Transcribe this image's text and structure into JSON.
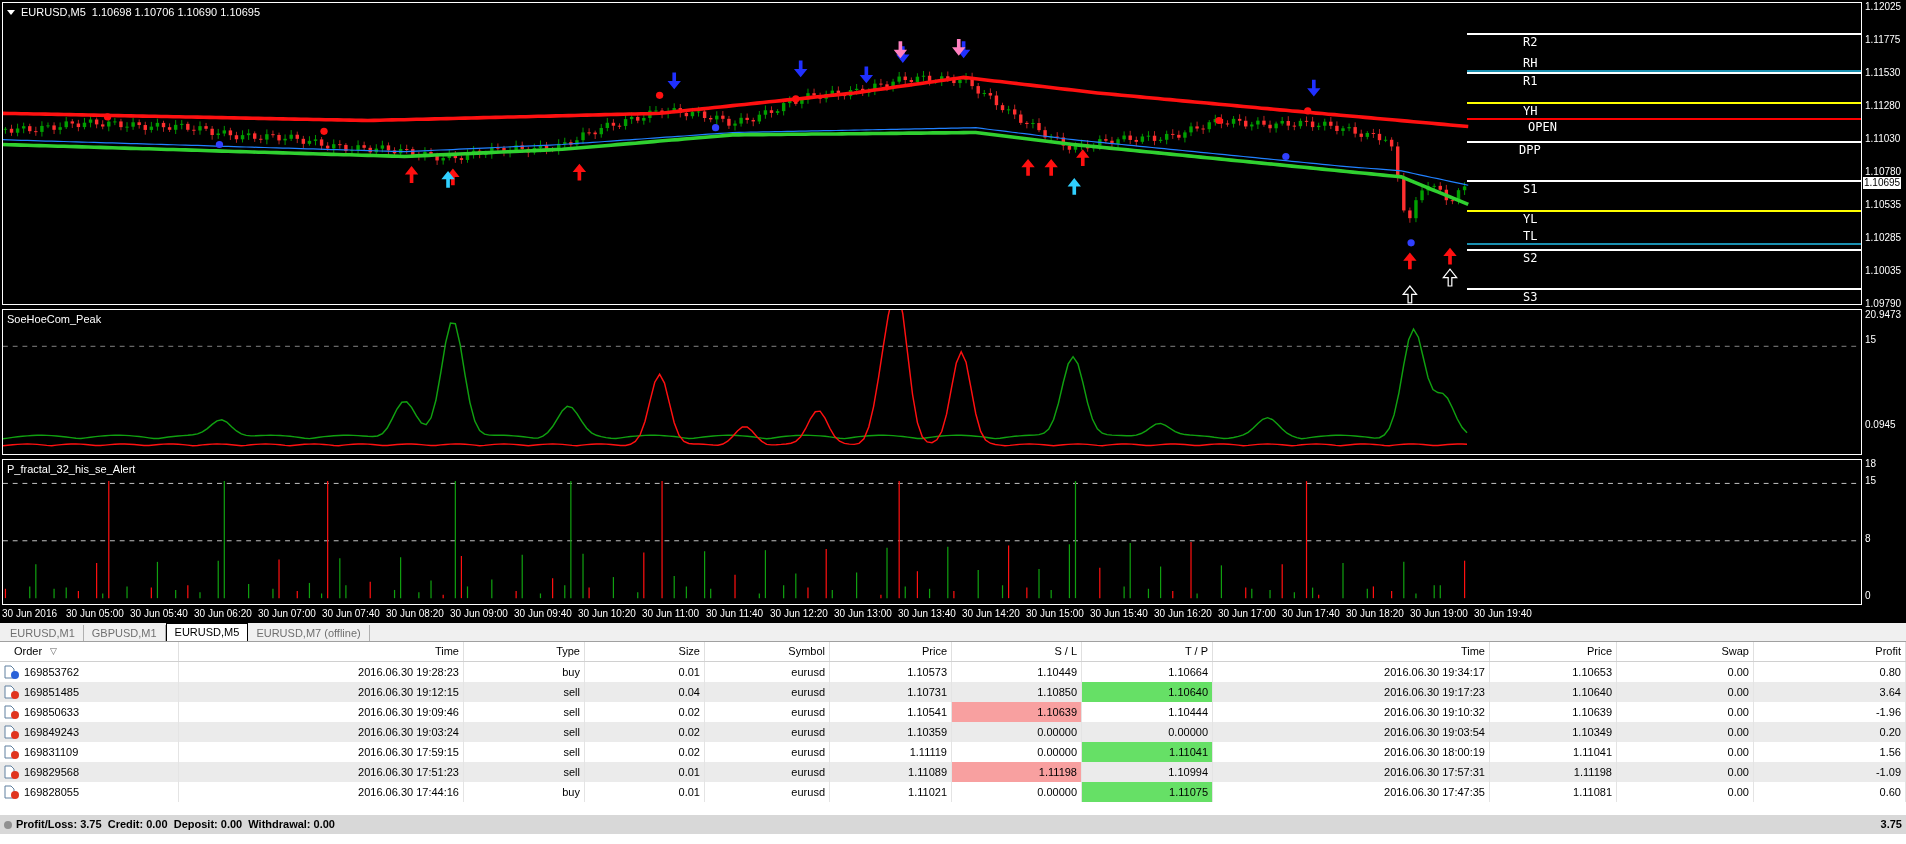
{
  "chart": {
    "symbol": "EURUSD,M5",
    "ohlc": "1.10698 1.10706 1.10690 1.10695",
    "price_ticks": [
      "1.12025",
      "1.11775",
      "1.11530",
      "1.11280",
      "1.11030",
      "1.10780",
      "1.10535",
      "1.10285",
      "1.10035",
      "1.09790"
    ],
    "current_price": "1.10695",
    "pivots": [
      {
        "label": "R2",
        "color": "#ffffff"
      },
      {
        "label": "RH",
        "color": "#1a8fb0"
      },
      {
        "label": "R1",
        "color": "#ffffff"
      },
      {
        "label": "YH",
        "color": "#ffff00"
      },
      {
        "label": "OPEN",
        "color": "#ff0000"
      },
      {
        "label": "DPP",
        "color": "#ffffff"
      },
      {
        "label": "S1",
        "color": "#ffffff"
      },
      {
        "label": "YL",
        "color": "#ffff00"
      },
      {
        "label": "TL",
        "color": "#1a8fb0"
      },
      {
        "label": "S2",
        "color": "#ffffff"
      },
      {
        "label": "S3",
        "color": "#ffffff"
      }
    ]
  },
  "indicators": [
    {
      "title": "SoeHoeCom_Peak",
      "ticks": [
        "20.9473",
        "15",
        "0.0945"
      ]
    },
    {
      "title": "P_fractal_32_his_se_Alert",
      "ticks": [
        "18",
        "15",
        "8",
        "0"
      ]
    }
  ],
  "time_axis": [
    "30 Jun 2016",
    "30 Jun 05:00",
    "30 Jun 05:40",
    "30 Jun 06:20",
    "30 Jun 07:00",
    "30 Jun 07:40",
    "30 Jun 08:20",
    "30 Jun 09:00",
    "30 Jun 09:40",
    "30 Jun 10:20",
    "30 Jun 11:00",
    "30 Jun 11:40",
    "30 Jun 12:20",
    "30 Jun 13:00",
    "30 Jun 13:40",
    "30 Jun 14:20",
    "30 Jun 15:00",
    "30 Jun 15:40",
    "30 Jun 16:20",
    "30 Jun 17:00",
    "30 Jun 17:40",
    "30 Jun 18:20",
    "30 Jun 19:00",
    "30 Jun 19:40"
  ],
  "tabs": [
    {
      "label": "EURUSD,M1",
      "selected": false
    },
    {
      "label": "GBPUSD,M1",
      "selected": false
    },
    {
      "label": "EURUSD,M5",
      "selected": true
    },
    {
      "label": "EURUSD,M7 (offline)",
      "selected": false
    }
  ],
  "table": {
    "sort_icon": "▽",
    "columns": [
      "Order",
      "Time",
      "Type",
      "Size",
      "Symbol",
      "Price",
      "S / L",
      "T / P",
      "Time",
      "Price",
      "Swap",
      "Profit"
    ],
    "rows": [
      {
        "color": "#2a62d8",
        "order": "169853762",
        "open_time": "2016.06.30 19:28:23",
        "type": "buy",
        "size": "0.01",
        "symbol": "eurusd",
        "open_price": "1.10573",
        "sl": "1.10449",
        "sl_hit": false,
        "tp": "1.10664",
        "tp_hit": false,
        "close_time": "2016.06.30 19:34:17",
        "close_price": "1.10653",
        "swap": "0.00",
        "profit": "0.80"
      },
      {
        "color": "#e0341e",
        "order": "169851485",
        "open_time": "2016.06.30 19:12:15",
        "type": "sell",
        "size": "0.04",
        "symbol": "eurusd",
        "open_price": "1.10731",
        "sl": "1.10850",
        "sl_hit": false,
        "tp": "1.10640",
        "tp_hit": true,
        "close_time": "2016.06.30 19:17:23",
        "close_price": "1.10640",
        "swap": "0.00",
        "profit": "3.64"
      },
      {
        "color": "#e0341e",
        "order": "169850633",
        "open_time": "2016.06.30 19:09:46",
        "type": "sell",
        "size": "0.02",
        "symbol": "eurusd",
        "open_price": "1.10541",
        "sl": "1.10639",
        "sl_hit": true,
        "tp": "1.10444",
        "tp_hit": false,
        "close_time": "2016.06.30 19:10:32",
        "close_price": "1.10639",
        "swap": "0.00",
        "profit": "-1.96"
      },
      {
        "color": "#e0341e",
        "order": "169849243",
        "open_time": "2016.06.30 19:03:24",
        "type": "sell",
        "size": "0.02",
        "symbol": "eurusd",
        "open_price": "1.10359",
        "sl": "0.00000",
        "sl_hit": false,
        "tp": "0.00000",
        "tp_hit": false,
        "close_time": "2016.06.30 19:03:54",
        "close_price": "1.10349",
        "swap": "0.00",
        "profit": "0.20"
      },
      {
        "color": "#e0341e",
        "order": "169831109",
        "open_time": "2016.06.30 17:59:15",
        "type": "sell",
        "size": "0.02",
        "symbol": "eurusd",
        "open_price": "1.11119",
        "sl": "0.00000",
        "sl_hit": false,
        "tp": "1.11041",
        "tp_hit": true,
        "close_time": "2016.06.30 18:00:19",
        "close_price": "1.11041",
        "swap": "0.00",
        "profit": "1.56"
      },
      {
        "color": "#e0341e",
        "order": "169829568",
        "open_time": "2016.06.30 17:51:23",
        "type": "sell",
        "size": "0.01",
        "symbol": "eurusd",
        "open_price": "1.11089",
        "sl": "1.11198",
        "sl_hit": true,
        "tp": "1.10994",
        "tp_hit": false,
        "close_time": "2016.06.30 17:57:31",
        "close_price": "1.11198",
        "swap": "0.00",
        "profit": "-1.09"
      },
      {
        "color": "#e0341e",
        "order": "169828055",
        "open_time": "2016.06.30 17:44:16",
        "type": "buy",
        "size": "0.01",
        "symbol": "eurusd",
        "open_price": "1.11021",
        "sl": "0.00000",
        "sl_hit": false,
        "tp": "1.11075",
        "tp_hit": true,
        "close_time": "2016.06.30 17:47:35",
        "close_price": "1.11081",
        "swap": "0.00",
        "profit": "0.60"
      }
    ],
    "footer": "Profit/Loss: 3.75  Credit: 0.00  Deposit: 0.00  Withdrawal: 0.00",
    "total": "3.75"
  }
}
